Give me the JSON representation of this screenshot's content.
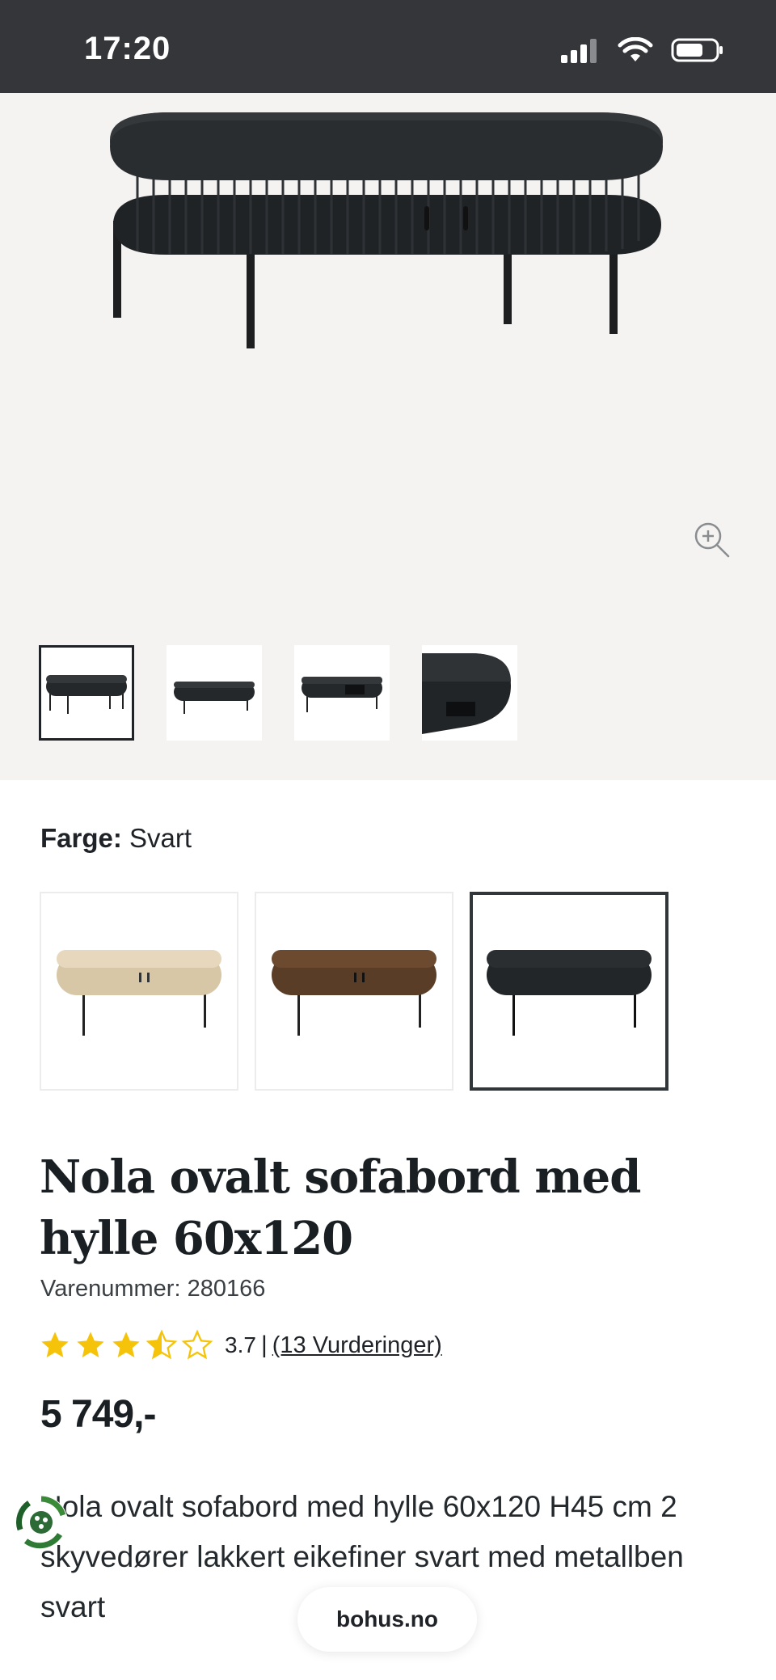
{
  "status_bar": {
    "time": "17:20"
  },
  "product": {
    "color_label": "Farge:",
    "color_value": "Svart",
    "title": "Nola ovalt sofabord med hylle 60x120",
    "sku": "Varenummer: 280166",
    "rating_value": "3.7",
    "rating_separator": "|",
    "reviews_link": "(13 Vurderinger)",
    "rating_stars": 3.5,
    "price": "5 749,-",
    "description": "Nola ovalt sofabord med hylle 60x120 H45 cm 2 skyvedører lakkert eikefiner svart med metallben svart"
  },
  "colors": {
    "swatches": [
      {
        "name": "light-oak",
        "color": "#e6d7bd"
      },
      {
        "name": "walnut",
        "color": "#6b4a30"
      },
      {
        "name": "black",
        "color": "#2b2e31"
      }
    ]
  },
  "footer": {
    "domain": "bohus.no"
  },
  "icons": {
    "zoom": "zoom-in-icon",
    "recycle": "recycle-icon",
    "star": "star-icon"
  },
  "accent": {
    "star": "#f5c40a",
    "text": "#1f2328"
  }
}
